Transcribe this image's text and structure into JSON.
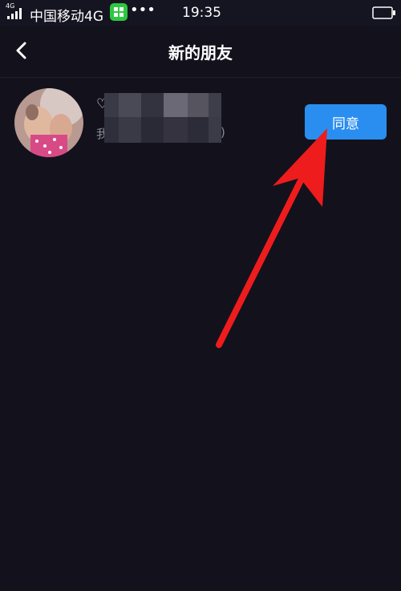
{
  "status_bar": {
    "signal_tag": "4G",
    "carrier": "中国移动4G",
    "time": "19:35",
    "more_glyph": "•••"
  },
  "nav": {
    "title": "新的朋友"
  },
  "friend_request": {
    "name_prefix": "♡",
    "message_prefix": "我",
    "message_suffix": ")",
    "accept_label": "同意"
  },
  "colors": {
    "background": "#13121c",
    "accent_button": "#2a8ef0",
    "annotation_arrow": "#ee1c1c"
  },
  "icons": {
    "back": "chevron-left-icon",
    "signal": "signal-bars-icon",
    "app": "app-grid-icon",
    "battery": "battery-icon"
  }
}
